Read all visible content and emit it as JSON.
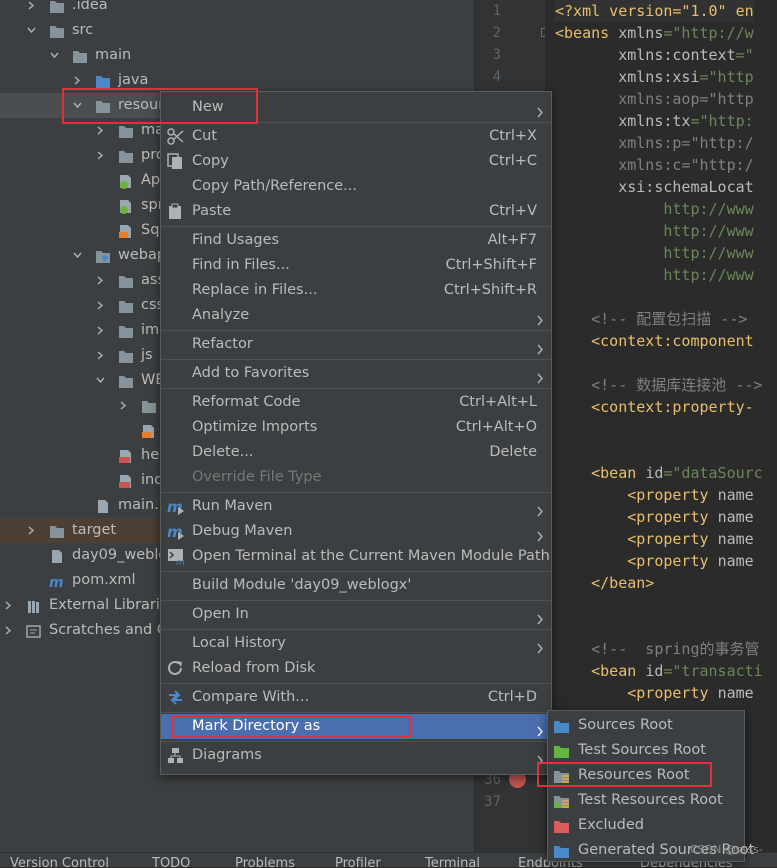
{
  "tree": {
    "rows": [
      {
        "label": ".idea",
        "icon": "folder-icon",
        "name": "tree-row-idea"
      },
      {
        "label": "src",
        "icon": "folder-icon",
        "name": "tree-row-src"
      },
      {
        "label": "main",
        "icon": "folder-icon",
        "name": "tree-row-main"
      },
      {
        "label": "java",
        "icon": "source-folder-icon",
        "name": "tree-row-java"
      },
      {
        "label": "resour",
        "icon": "folder-icon",
        "name": "tree-row-resources"
      },
      {
        "label": "ma",
        "icon": "folder-icon",
        "name": "tree-row-ma"
      },
      {
        "label": "pro",
        "icon": "folder-icon",
        "name": "tree-row-pro"
      },
      {
        "label": "Ap",
        "icon": "spring-xml-icon",
        "name": "tree-row-ap"
      },
      {
        "label": "spr",
        "icon": "spring-xml-icon",
        "name": "tree-row-spr"
      },
      {
        "label": "Sql",
        "icon": "xml-file-icon",
        "name": "tree-row-sql"
      },
      {
        "label": "webap",
        "icon": "web-folder-icon",
        "name": "tree-row-webapp"
      },
      {
        "label": "ass",
        "icon": "folder-icon",
        "name": "tree-row-ass"
      },
      {
        "label": "css",
        "icon": "folder-icon",
        "name": "tree-row-css"
      },
      {
        "label": "img",
        "icon": "folder-icon",
        "name": "tree-row-img"
      },
      {
        "label": "js",
        "icon": "folder-icon",
        "name": "tree-row-js"
      },
      {
        "label": "WE",
        "icon": "folder-icon",
        "name": "tree-row-web-inf"
      },
      {
        "label": "",
        "icon": "folder-icon",
        "name": "tree-row-sub"
      },
      {
        "label": "",
        "icon": "web-xml-icon",
        "name": "tree-row-webxml"
      },
      {
        "label": "hel",
        "icon": "jsp-file-icon",
        "name": "tree-row-hel"
      },
      {
        "label": "ind",
        "icon": "jsp-file-icon",
        "name": "tree-row-ind"
      },
      {
        "label": "main.i",
        "icon": "file-icon",
        "name": "tree-row-main-iml"
      },
      {
        "label": "target",
        "icon": "folder-icon",
        "name": "tree-row-target"
      },
      {
        "label": "day09_weblo",
        "icon": "file-icon",
        "name": "tree-row-iml"
      },
      {
        "label": "pom.xml",
        "icon": "maven-icon",
        "name": "tree-row-pom"
      },
      {
        "label": "External Libraries",
        "icon": "library-icon",
        "name": "tree-row-external-libraries"
      },
      {
        "label": "Scratches and Co",
        "icon": "scratches-icon",
        "name": "tree-row-scratches"
      }
    ]
  },
  "editor": {
    "line_numbers": [
      "1",
      "2",
      "3",
      "4"
    ],
    "line_numbers_bottom": [
      "36",
      "37"
    ],
    "lines": [
      {
        "parts": [
          [
            "c-decl",
            "<?xml version=\"1.0\" en"
          ]
        ]
      },
      {
        "parts": [
          [
            "c-tag",
            "<beans "
          ],
          [
            "c-attr",
            "xmlns"
          ],
          [
            "c-str",
            "=\"http://w"
          ]
        ]
      },
      {
        "parts": [
          [
            "c-attr",
            "       xmlns:context"
          ],
          [
            "c-str",
            "=\""
          ]
        ]
      },
      {
        "parts": [
          [
            "c-attr",
            "       xmlns:xsi"
          ],
          [
            "c-str",
            "=\"http"
          ]
        ]
      },
      {
        "parts": [
          [
            "c-comment",
            "       xmlns:aop=\"http"
          ]
        ]
      },
      {
        "parts": [
          [
            "c-attr",
            "       xmlns:tx"
          ],
          [
            "c-str",
            "=\"http:"
          ]
        ]
      },
      {
        "parts": [
          [
            "c-comment",
            "       xmlns:p=\"http:/"
          ]
        ]
      },
      {
        "parts": [
          [
            "c-comment",
            "       xmlns:c=\"http:/"
          ]
        ]
      },
      {
        "parts": [
          [
            "c-attr",
            "       xsi:schemaLocat"
          ]
        ]
      },
      {
        "parts": [
          [
            "c-str",
            "            http://www"
          ]
        ]
      },
      {
        "parts": [
          [
            "c-str",
            "            http://www"
          ]
        ]
      },
      {
        "parts": [
          [
            "c-str",
            "            http://www"
          ]
        ]
      },
      {
        "parts": [
          [
            "c-str",
            "            http://www"
          ]
        ]
      },
      {
        "parts": [
          [
            "c-attr",
            ""
          ]
        ]
      },
      {
        "parts": [
          [
            "c-comment",
            "    <!-- 配置包扫描 -->"
          ]
        ]
      },
      {
        "parts": [
          [
            "c-tag",
            "    <context:component"
          ]
        ]
      },
      {
        "parts": [
          [
            "c-attr",
            ""
          ]
        ]
      },
      {
        "parts": [
          [
            "c-comment",
            "    <!-- 数据库连接池 -->"
          ]
        ]
      },
      {
        "parts": [
          [
            "c-tag",
            "    <context:property-"
          ]
        ]
      },
      {
        "parts": [
          [
            "c-attr",
            ""
          ]
        ]
      },
      {
        "parts": [
          [
            "c-attr",
            ""
          ]
        ]
      },
      {
        "parts": [
          [
            "c-tag",
            "    <bean "
          ],
          [
            "c-attr",
            "id"
          ],
          [
            "c-str",
            "=\"dataSourc"
          ]
        ]
      },
      {
        "parts": [
          [
            "c-tag",
            "        <property "
          ],
          [
            "c-attr",
            "name"
          ]
        ]
      },
      {
        "parts": [
          [
            "c-tag",
            "        <property "
          ],
          [
            "c-attr",
            "name"
          ]
        ]
      },
      {
        "parts": [
          [
            "c-tag",
            "        <property "
          ],
          [
            "c-attr",
            "name"
          ]
        ]
      },
      {
        "parts": [
          [
            "c-tag",
            "        <property "
          ],
          [
            "c-attr",
            "name"
          ]
        ]
      },
      {
        "parts": [
          [
            "c-tag",
            "    </bean>"
          ]
        ]
      },
      {
        "parts": [
          [
            "c-attr",
            ""
          ]
        ]
      },
      {
        "parts": [
          [
            "c-attr",
            ""
          ]
        ]
      },
      {
        "parts": [
          [
            "c-comment",
            "    <!--  spring的事务管"
          ]
        ]
      },
      {
        "parts": [
          [
            "c-tag",
            "    <bean "
          ],
          [
            "c-attr",
            "id"
          ],
          [
            "c-str",
            "=\"transacti"
          ]
        ]
      },
      {
        "parts": [
          [
            "c-tag",
            "        <property "
          ],
          [
            "c-attr",
            "name"
          ]
        ]
      }
    ]
  },
  "context_menu": {
    "items": [
      {
        "label": "New",
        "name": "menu-item-new",
        "submenu": true,
        "highlight": false,
        "icon": ""
      },
      {
        "sep": true
      },
      {
        "label": "Cut",
        "shortcut": "Ctrl+X",
        "name": "menu-item-cut",
        "icon": "scissors-icon"
      },
      {
        "label": "Copy",
        "shortcut": "Ctrl+C",
        "name": "menu-item-copy",
        "icon": "copy-icon"
      },
      {
        "label": "Copy Path/Reference...",
        "name": "menu-item-copy-path",
        "icon": ""
      },
      {
        "label": "Paste",
        "shortcut": "Ctrl+V",
        "name": "menu-item-paste",
        "icon": "clipboard-icon"
      },
      {
        "sep": true
      },
      {
        "label": "Find Usages",
        "shortcut": "Alt+F7",
        "name": "menu-item-find-usages",
        "icon": ""
      },
      {
        "label": "Find in Files...",
        "shortcut": "Ctrl+Shift+F",
        "name": "menu-item-find-in-files",
        "icon": ""
      },
      {
        "label": "Replace in Files...",
        "shortcut": "Ctrl+Shift+R",
        "name": "menu-item-replace-in-files",
        "icon": ""
      },
      {
        "label": "Analyze",
        "submenu": true,
        "name": "menu-item-analyze",
        "icon": ""
      },
      {
        "sep": true
      },
      {
        "label": "Refactor",
        "submenu": true,
        "name": "menu-item-refactor",
        "icon": ""
      },
      {
        "sep": true
      },
      {
        "label": "Add to Favorites",
        "submenu": true,
        "name": "menu-item-add-to-favorites",
        "icon": ""
      },
      {
        "sep": true
      },
      {
        "label": "Reformat Code",
        "shortcut": "Ctrl+Alt+L",
        "name": "menu-item-reformat-code",
        "icon": ""
      },
      {
        "label": "Optimize Imports",
        "shortcut": "Ctrl+Alt+O",
        "name": "menu-item-optimize-imports",
        "icon": ""
      },
      {
        "label": "Delete...",
        "shortcut": "Delete",
        "name": "menu-item-delete",
        "icon": ""
      },
      {
        "label": "Override File Type",
        "disabled": true,
        "name": "menu-item-override-file-type",
        "icon": ""
      },
      {
        "sep": true
      },
      {
        "label": "Run Maven",
        "submenu": true,
        "name": "menu-item-run-maven",
        "icon": "maven-run-icon"
      },
      {
        "label": "Debug Maven",
        "submenu": true,
        "name": "menu-item-debug-maven",
        "icon": "maven-debug-icon"
      },
      {
        "label": "Open Terminal at the Current Maven Module Path",
        "name": "menu-item-open-terminal",
        "icon": "terminal-icon"
      },
      {
        "sep": true
      },
      {
        "label": "Build Module 'day09_weblogx'",
        "name": "menu-item-build-module",
        "icon": ""
      },
      {
        "sep": true
      },
      {
        "label": "Open In",
        "submenu": true,
        "name": "menu-item-open-in",
        "icon": ""
      },
      {
        "sep": true
      },
      {
        "label": "Local History",
        "submenu": true,
        "name": "menu-item-local-history",
        "icon": ""
      },
      {
        "label": "Reload from Disk",
        "name": "menu-item-reload-from-disk",
        "icon": "reload-icon"
      },
      {
        "sep": true
      },
      {
        "label": "Compare With...",
        "shortcut": "Ctrl+D",
        "name": "menu-item-compare-with",
        "icon": "compare-icon"
      },
      {
        "sep": true
      },
      {
        "label": "Mark Directory as",
        "submenu": true,
        "highlight": true,
        "name": "menu-item-mark-directory-as",
        "icon": ""
      },
      {
        "sep": true
      },
      {
        "label": "Diagrams",
        "submenu": true,
        "name": "menu-item-diagrams",
        "icon": "diagram-icon"
      }
    ]
  },
  "submenu": {
    "items": [
      {
        "label": "Sources Root",
        "name": "submenu-item-sources-root",
        "icon": "sources-root-icon",
        "color": "#4a88c7"
      },
      {
        "label": "Test Sources Root",
        "name": "submenu-item-test-sources-root",
        "icon": "test-sources-root-icon",
        "color": "#62b543"
      },
      {
        "label": "Resources Root",
        "name": "submenu-item-resources-root",
        "icon": "resources-root-icon",
        "color": "#c7a65a"
      },
      {
        "label": "Test Resources Root",
        "name": "submenu-item-test-resources-root",
        "icon": "test-resources-root-icon",
        "color": "#c7a65a"
      },
      {
        "label": "Excluded",
        "name": "submenu-item-excluded",
        "icon": "excluded-icon",
        "color": "#db5c5c"
      },
      {
        "label": "Generated Sources Root",
        "name": "submenu-item-generated-sources-root",
        "icon": "generated-sources-root-icon",
        "color": "#4a88c7"
      }
    ]
  },
  "bottom_bar": {
    "items": [
      {
        "label": "Version Control",
        "name": "tool-version-control"
      },
      {
        "label": "TODO",
        "name": "tool-todo"
      },
      {
        "label": "Problems",
        "name": "tool-problems"
      },
      {
        "label": "Profiler",
        "name": "tool-profiler"
      },
      {
        "label": "Terminal",
        "name": "tool-terminal"
      },
      {
        "label": "Endpoints",
        "name": "tool-endpoints"
      },
      {
        "label": "Dependencies",
        "name": "tool-dependencies"
      }
    ]
  },
  "watermark": "CSDN @ssss-",
  "colors": {
    "menu_highlight": "#4b6eaf",
    "annotation_red": "#e0313a",
    "folder": "#87939a",
    "source_folder": "#4a88c7"
  }
}
